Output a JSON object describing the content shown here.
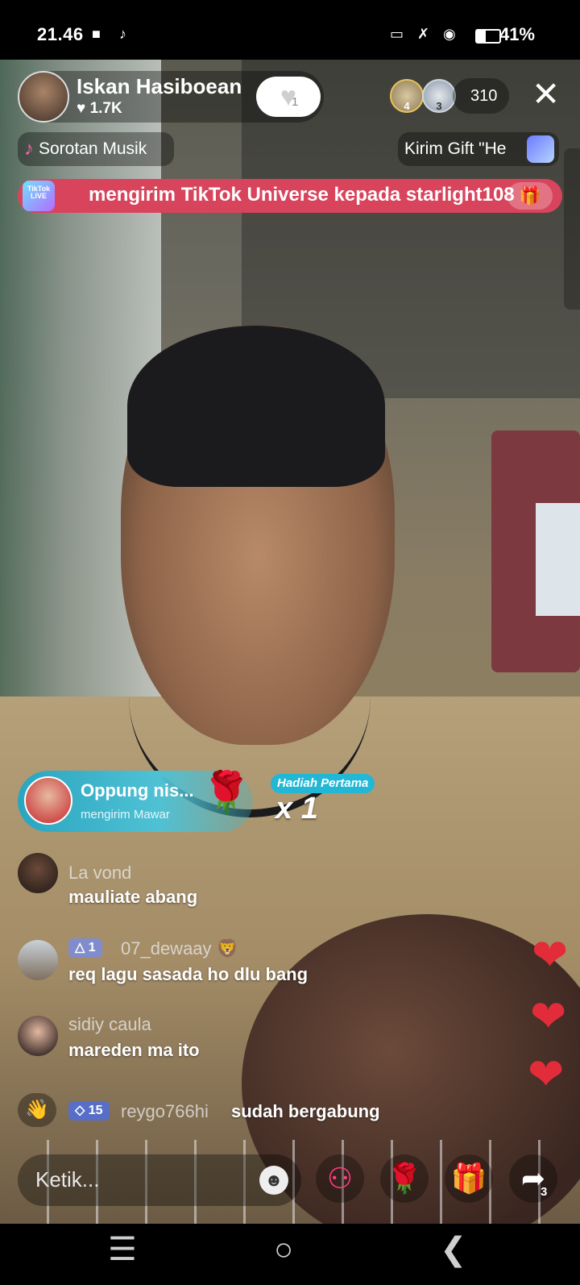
{
  "status_bar": {
    "time": "21.46",
    "battery": "41%",
    "battery_level": 0.41
  },
  "host": {
    "name": "Iskan Hasiboean",
    "likes": "1.7K",
    "follow_count": "1"
  },
  "viewers": {
    "top1_rank": "4",
    "top2_rank": "3",
    "count": "310"
  },
  "pills": {
    "music": "Sorotan Musik",
    "gift_promo": "Kirim Gift \"He"
  },
  "banner": {
    "logo_text": "TikTok LIVE",
    "text": "mengirim TikTok Universe kepada starlight108"
  },
  "gift_notice": {
    "sender": "Oppung nis...",
    "action": "mengirim Mawar",
    "first_label": "Hadiah Pertama",
    "count": "x 1"
  },
  "chat": [
    {
      "user": "La vond",
      "message": "mauliate abang"
    },
    {
      "badge": "1",
      "user": "07_dewaay",
      "message": "req lagu sasada ho dlu bang"
    },
    {
      "user": "sidiy caula",
      "message": "mareden ma ito"
    }
  ],
  "join": {
    "badge": "15",
    "user": "reygo766hi",
    "text": "sudah bergabung"
  },
  "bottom": {
    "placeholder": "Ketik...",
    "share_count": "3"
  },
  "colors": {
    "banner": "#d9445d",
    "gift_pill": "#2aa5c0",
    "heart": "#e32c3a"
  }
}
